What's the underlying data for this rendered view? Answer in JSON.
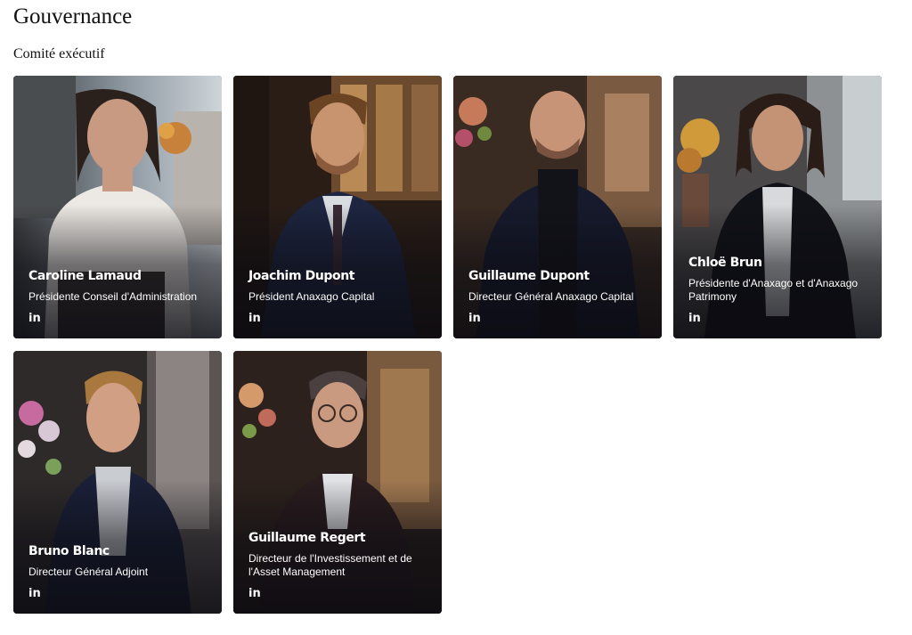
{
  "page": {
    "title": "Gouvernance",
    "section_title": "Comité exécutif"
  },
  "members": [
    {
      "name": "Caroline Lamaud",
      "role": "Présidente Conseil d'Administration",
      "icon": "linkedin-icon",
      "linkedin_glyph": "in"
    },
    {
      "name": "Joachim Dupont",
      "role": "Président Anaxago Capital",
      "icon": "linkedin-icon",
      "linkedin_glyph": "in"
    },
    {
      "name": "Guillaume Dupont",
      "role": "Directeur Général Anaxago Capital",
      "icon": "linkedin-icon",
      "linkedin_glyph": "in"
    },
    {
      "name": "Chloë Brun",
      "role": "Présidente d'Anaxago et d'Anaxago Patrimony",
      "icon": "linkedin-icon",
      "linkedin_glyph": "in"
    },
    {
      "name": "Bruno Blanc",
      "role": "Directeur Général Adjoint",
      "icon": "linkedin-icon",
      "linkedin_glyph": "in"
    },
    {
      "name": "Guillaume Regert",
      "role": "Directeur de l'Investissement et de l'Asset Management",
      "icon": "linkedin-icon",
      "linkedin_glyph": "in"
    }
  ],
  "colors": {
    "card_background": "#1c1d24",
    "text_on_card": "#ffffff",
    "page_text": "#111111"
  }
}
